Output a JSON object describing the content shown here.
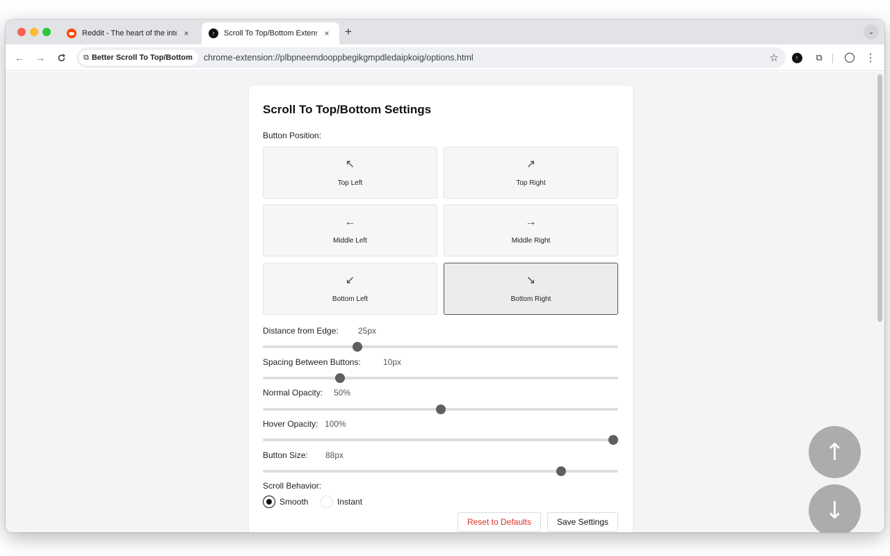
{
  "browser": {
    "tabs": [
      {
        "title": "Reddit - The heart of the inte",
        "close": "×",
        "favicon": "reddit-icon"
      },
      {
        "title": "Scroll To Top/Bottom Extensio",
        "close": "×",
        "favicon": "scroll-extension-icon"
      }
    ],
    "new_tab": "+",
    "tab_search": "⌄",
    "nav": {
      "back": "←",
      "forward": "→",
      "reload": "C"
    },
    "site_chip": "Better Scroll To Top/Bottom",
    "url": "chrome-extension://plbpneemdooppbegikgmpdledaipkoig/options.html",
    "toolbar_icons": {
      "star": "☆",
      "scroll_ext": "↑",
      "puzzle": "⧉",
      "menu": "⋮"
    }
  },
  "settings": {
    "title": "Scroll To Top/Bottom Settings",
    "button_position_label": "Button Position:",
    "positions": [
      {
        "arrow": "↖",
        "label": "Top Left",
        "selected": false
      },
      {
        "arrow": "↗",
        "label": "Top Right",
        "selected": false
      },
      {
        "arrow": "←",
        "label": "Middle Left",
        "selected": false
      },
      {
        "arrow": "→",
        "label": "Middle Right",
        "selected": false
      },
      {
        "arrow": "↙",
        "label": "Bottom Left",
        "selected": false
      },
      {
        "arrow": "↘",
        "label": "Bottom Right",
        "selected": true
      }
    ],
    "sliders": [
      {
        "label": "Distance from Edge:",
        "value": "25px",
        "level": 0.26
      },
      {
        "label": "Spacing Between Buttons:",
        "value": "10px",
        "level": 0.21
      },
      {
        "label": "Normal Opacity:",
        "value": "50%",
        "level": 0.5
      },
      {
        "label": "Hover Opacity:",
        "value": "100%",
        "level": 1.0
      },
      {
        "label": "Button Size:",
        "value": "88px",
        "level": 0.85
      }
    ],
    "scroll_behavior_label": "Scroll Behavior:",
    "scroll_options": [
      {
        "label": "Smooth",
        "checked": true
      },
      {
        "label": "Instant",
        "checked": false
      }
    ],
    "reset_label": "Reset to Defaults",
    "save_label": "Save Settings"
  },
  "floating": {
    "up": "↑",
    "down": "↓"
  },
  "colors": {
    "reset_text": "#d93025",
    "accent": "#111111",
    "slider_thumb": "#5f5f5f",
    "floating_button": "#8a8a8a"
  }
}
